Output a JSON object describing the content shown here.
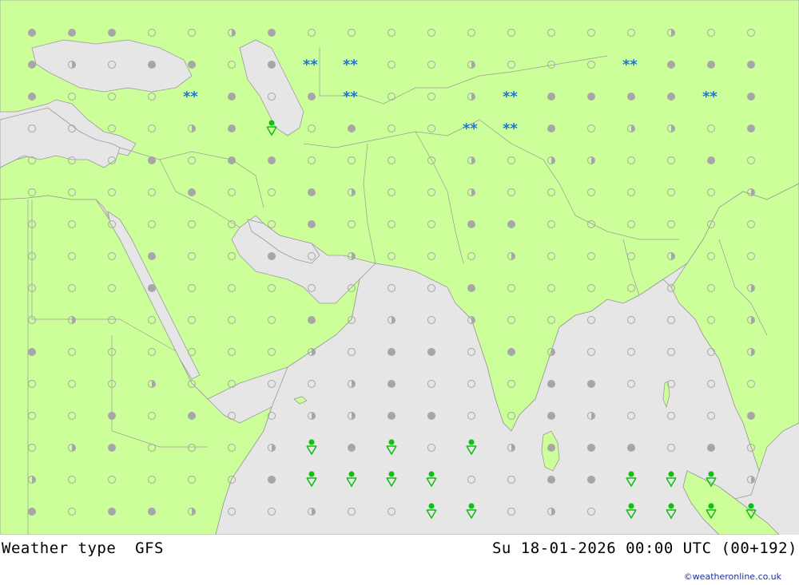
{
  "footer": {
    "title": "Weather type  GFS",
    "datetime": "Su 18-01-2026 00:00 UTC (00+192)",
    "credit": "©weatheronline.co.uk"
  },
  "colors": {
    "land": "#ccff99",
    "sea": "#e6e6e6",
    "border": "#9a9a9a",
    "cloud_symbol": "#a6a6a6",
    "snow_symbol": "#1a73e8",
    "shower_symbol": "#0fbf0f"
  },
  "legend_symbols": {
    "full_cloud": "filled-circle-icon",
    "clear": "empty-circle-icon",
    "partly_cloudy": "half-circle-icon",
    "snow": "snow-icon",
    "shower": "rain-shower-icon"
  },
  "grid_rows": [
    "FFFEEHFEEEEEEEEEHEE",
    "FHEFFEFFFEEHEEEEFFF",
    "FEEEEFEFEEEHEFFFFEF",
    "EEEEHFFEFEEEEFEHHEF",
    "EEEFEFFEEEEHEHHEEFE",
    "EEEEFEEFHEEHEEEEEEH",
    "EEEEEEEFEEEFFEEEEEE",
    "EEEFEEFEHEEEHEEEHEE",
    "EEEFEEEEEEEFEEEEEEH",
    "EHEEEEEFEHEHEEEEEEH",
    "FEEEEEEHEFFEFHEEEEH",
    "EEEHEEEEHFEEEFFEEEE",
    "EEFEFEEHHFFEEFHEEEF",
    "EHFEEEHEFHEEHFFFEFE",
    "HEEEEEFEFEEEEFFFEEH",
    "FEFFHEEHEEEEEHEFEEH"
  ],
  "snow_cells": [
    [
      1,
      7
    ],
    [
      1,
      8
    ],
    [
      1,
      15
    ],
    [
      2,
      4
    ],
    [
      2,
      8
    ],
    [
      2,
      12
    ],
    [
      2,
      17
    ],
    [
      3,
      11
    ],
    [
      3,
      12
    ]
  ],
  "shower_cells": [
    [
      3,
      6
    ],
    [
      13,
      7
    ],
    [
      13,
      9
    ],
    [
      13,
      11
    ],
    [
      14,
      7
    ],
    [
      14,
      8
    ],
    [
      14,
      9
    ],
    [
      14,
      10
    ],
    [
      14,
      15
    ],
    [
      14,
      16
    ],
    [
      14,
      17
    ],
    [
      15,
      10
    ],
    [
      15,
      11
    ],
    [
      15,
      15
    ],
    [
      15,
      16
    ],
    [
      15,
      17
    ],
    [
      15,
      18
    ]
  ]
}
